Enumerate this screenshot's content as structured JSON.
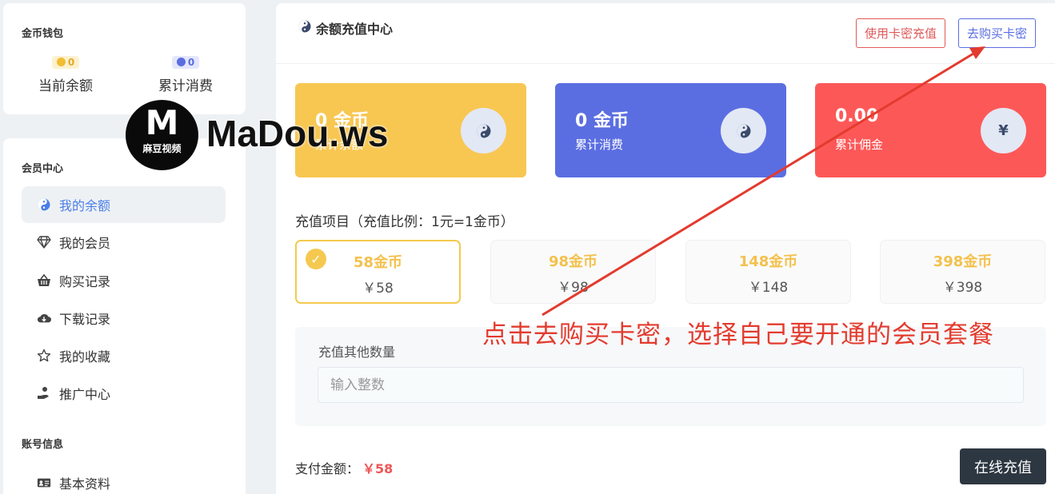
{
  "wallet": {
    "title": "金币钱包",
    "balance_value": "0",
    "balance_label": "当前余额",
    "spent_value": "0",
    "spent_label": "累计消费"
  },
  "sidebar": {
    "section_member": "会员中心",
    "items": [
      {
        "label": "我的余额",
        "icon": "yin-yang-icon",
        "active": true
      },
      {
        "label": "我的会员",
        "icon": "diamond-icon"
      },
      {
        "label": "购买记录",
        "icon": "basket-icon"
      },
      {
        "label": "下载记录",
        "icon": "cloud-download-icon"
      },
      {
        "label": "我的收藏",
        "icon": "star-icon"
      },
      {
        "label": "推广中心",
        "icon": "hand-coin-icon"
      }
    ],
    "section_account": "账号信息",
    "account_items": [
      {
        "label": "基本资料",
        "icon": "id-card-icon"
      }
    ]
  },
  "main": {
    "title": "余额充值中心",
    "btn_card_recharge": "使用卡密充值",
    "btn_buy_card": "去购买卡密",
    "stats": [
      {
        "value": "0 金币",
        "label": "累计余额",
        "icon": "yin-yang-icon",
        "color": "#f8c752"
      },
      {
        "value": "0 金币",
        "label": "累计消费",
        "icon": "yin-yang-icon",
        "color": "#5b6ee1"
      },
      {
        "value": "0.00",
        "label": "累计佣金",
        "icon": "¥",
        "color": "#fd5858"
      }
    ],
    "packages_title": "充值项目（充值比例：1元=1金币）",
    "packages": [
      {
        "coins": "58金币",
        "price": "￥58",
        "selected": true
      },
      {
        "coins": "98金币",
        "price": "￥98"
      },
      {
        "coins": "148金币",
        "price": "￥148"
      },
      {
        "coins": "398金币",
        "price": "￥398"
      }
    ],
    "other_label": "充值其他数量",
    "other_placeholder": "输入整数",
    "pay_label": "支付金额：",
    "pay_amount": "￥58",
    "pay_button": "在线充值"
  },
  "watermark": {
    "logo_letter": "M",
    "logo_sub": "麻豆视频",
    "text": "MaDou.ws"
  },
  "annotation": {
    "text": "点击去购买卡密，选择自己要开通的会员套餐",
    "color": "#e33b2e"
  }
}
